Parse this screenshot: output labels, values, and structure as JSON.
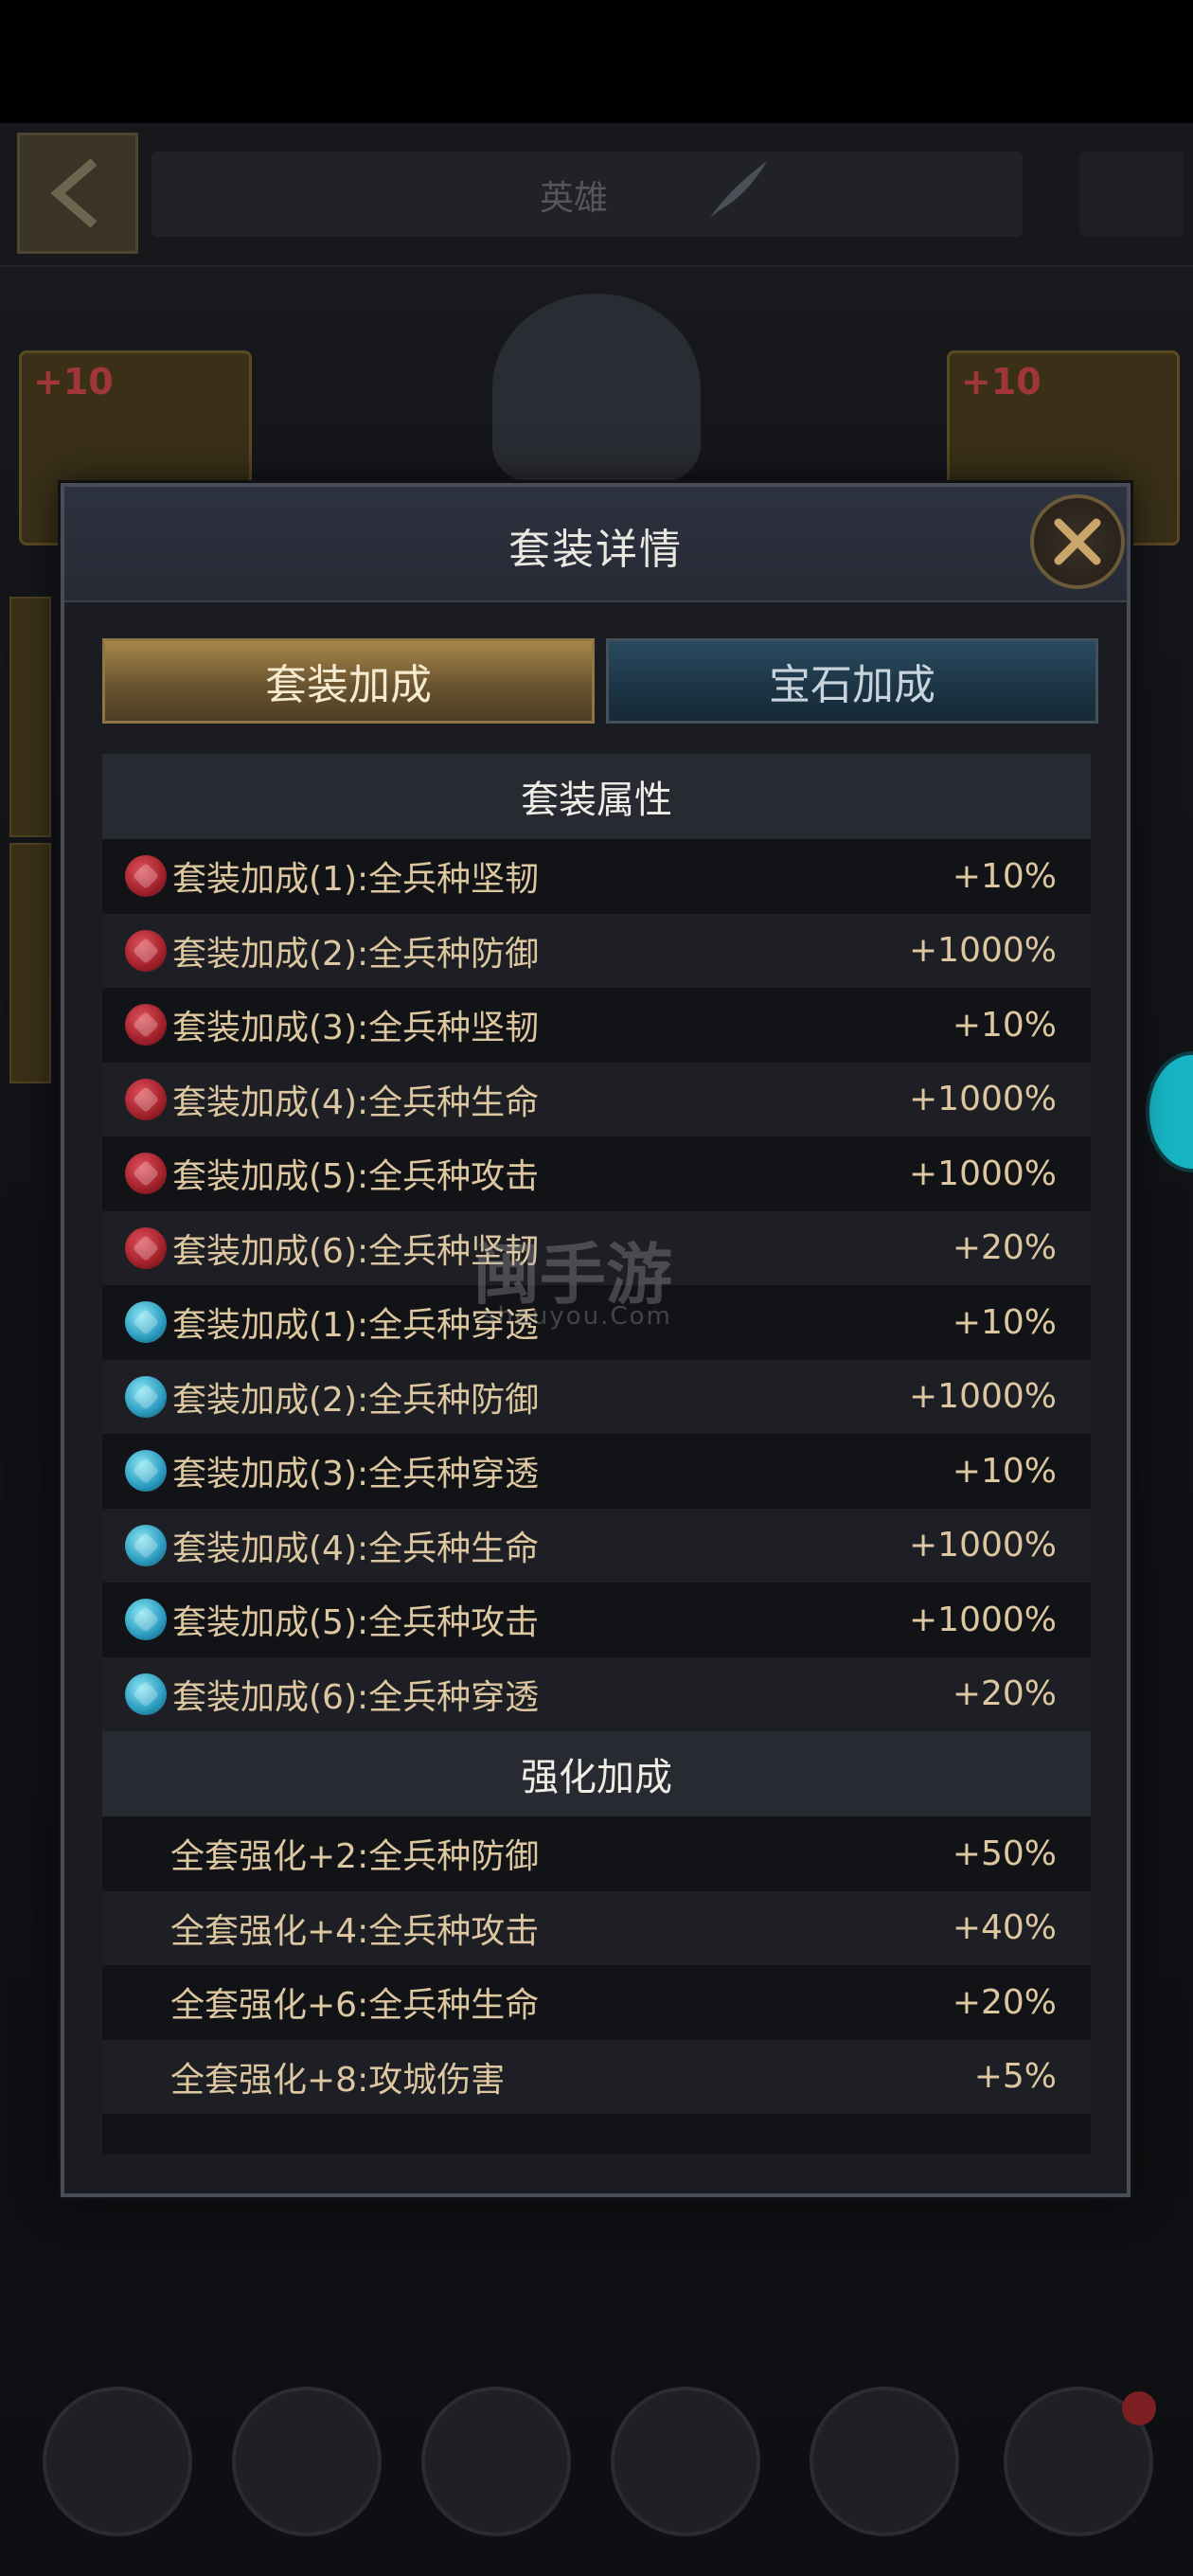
{
  "scene": {
    "title": "英雄"
  },
  "modal": {
    "title": "套装详情",
    "tabs": [
      {
        "label": "套装加成",
        "active": true
      },
      {
        "label": "宝石加成",
        "active": false
      }
    ],
    "sections": [
      {
        "header": "套装属性",
        "rows": [
          {
            "icon": "red-gem-icon",
            "label": "套装加成(1):全兵种坚韧",
            "value": "+10%"
          },
          {
            "icon": "red-gem-icon",
            "label": "套装加成(2):全兵种防御",
            "value": "+1000%"
          },
          {
            "icon": "red-gem-icon",
            "label": "套装加成(3):全兵种坚韧",
            "value": "+10%"
          },
          {
            "icon": "red-gem-icon",
            "label": "套装加成(4):全兵种生命",
            "value": "+1000%"
          },
          {
            "icon": "red-gem-icon",
            "label": "套装加成(5):全兵种攻击",
            "value": "+1000%"
          },
          {
            "icon": "red-gem-icon",
            "label": "套装加成(6):全兵种坚韧",
            "value": "+20%"
          },
          {
            "icon": "blue-gem-icon",
            "label": "套装加成(1):全兵种穿透",
            "value": "+10%"
          },
          {
            "icon": "blue-gem-icon",
            "label": "套装加成(2):全兵种防御",
            "value": "+1000%"
          },
          {
            "icon": "blue-gem-icon",
            "label": "套装加成(3):全兵种穿透",
            "value": "+10%"
          },
          {
            "icon": "blue-gem-icon",
            "label": "套装加成(4):全兵种生命",
            "value": "+1000%"
          },
          {
            "icon": "blue-gem-icon",
            "label": "套装加成(5):全兵种攻击",
            "value": "+1000%"
          },
          {
            "icon": "blue-gem-icon",
            "label": "套装加成(6):全兵种穿透",
            "value": "+20%"
          }
        ]
      },
      {
        "header": "强化加成",
        "rows": [
          {
            "label": "全套强化+2:全兵种防御",
            "value": "+50%"
          },
          {
            "label": "全套强化+4:全兵种攻击",
            "value": "+40%"
          },
          {
            "label": "全套强化+6:全兵种生命",
            "value": "+20%"
          },
          {
            "label": "全套强化+8:攻城伤害",
            "value": "+5%"
          }
        ]
      }
    ]
  },
  "equipment_badges": [
    "+10",
    "+10"
  ],
  "watermark": {
    "main": "闽手游",
    "sub": "shouyou.Com"
  },
  "colors": {
    "accent_gold": "#ddc7a0",
    "tab_active": "#8d7545",
    "tab_inactive": "#2a4a60",
    "red_gem": "#c0303a",
    "blue_gem": "#3fb4d6"
  }
}
